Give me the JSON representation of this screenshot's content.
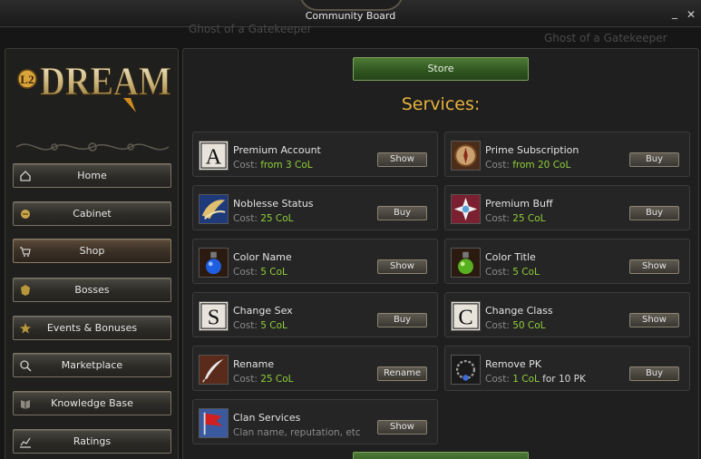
{
  "window": {
    "title": "Community Board",
    "watermark": "Ghost of a Gatekeeper"
  },
  "logo": {
    "text": "DREAM",
    "badge": "L2"
  },
  "nav": [
    {
      "label": "Home",
      "icon": "home-icon"
    },
    {
      "label": "Cabinet",
      "icon": "cabinet-icon"
    },
    {
      "label": "Shop",
      "icon": "cart-icon",
      "active": true
    },
    {
      "label": "Bosses",
      "icon": "boss-icon"
    },
    {
      "label": "Events & Bonuses",
      "icon": "events-icon"
    },
    {
      "label": "Marketplace",
      "icon": "marketplace-icon"
    },
    {
      "label": "Knowledge Base",
      "icon": "book-icon"
    },
    {
      "label": "Ratings",
      "icon": "ratings-icon"
    }
  ],
  "main": {
    "store_label": "Store",
    "services_title": "Services:",
    "cost_prefix": "Cost: ",
    "services": [
      {
        "name": "Premium Account",
        "cost": "from 3 CoL",
        "button": "Show",
        "icon": "letter-a-icon"
      },
      {
        "name": "Prime Subscription",
        "cost": "from 20 CoL",
        "button": "Buy",
        "icon": "compass-icon"
      },
      {
        "name": "Noblesse Status",
        "cost": "25 CoL",
        "button": "Buy",
        "icon": "wings-icon"
      },
      {
        "name": "Premium Buff",
        "cost": "25 CoL",
        "button": "Buy",
        "icon": "buff-icon"
      },
      {
        "name": "Color Name",
        "cost": "5 CoL",
        "button": "Show",
        "icon": "blue-potion-icon"
      },
      {
        "name": "Color Title",
        "cost": "5 CoL",
        "button": "Show",
        "icon": "green-potion-icon"
      },
      {
        "name": "Change Sex",
        "cost": "5 CoL",
        "button": "Buy",
        "icon": "letter-s-icon"
      },
      {
        "name": "Change Class",
        "cost": "50 CoL",
        "button": "Show",
        "icon": "letter-c-icon"
      },
      {
        "name": "Rename",
        "cost": "25 CoL",
        "button": "Rename",
        "icon": "quill-icon"
      },
      {
        "name": "Remove PK",
        "cost": "1 CoL",
        "cost_extra": " for 10 PK",
        "button": "Buy",
        "icon": "necklace-icon"
      },
      {
        "name": "Clan Services",
        "note": "Clan name, reputation, etc",
        "button": "Show",
        "icon": "clan-flag-icon"
      }
    ]
  },
  "colors": {
    "accent_gold": "#e6b23c",
    "cost_green": "#8fcf3a",
    "store_green": "#3d6a2a"
  }
}
